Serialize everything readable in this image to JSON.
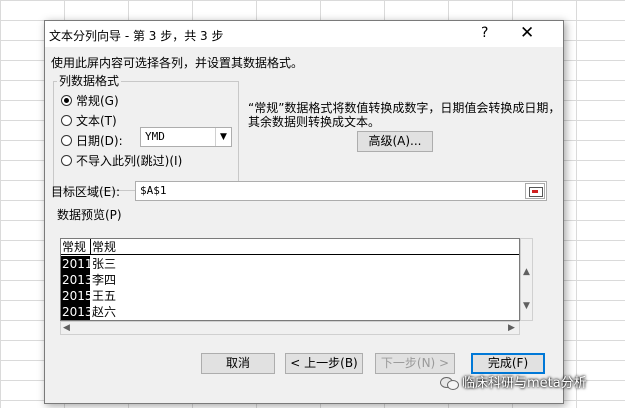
{
  "window": {
    "title": "文本分列向导 - 第 3 步，共 3 步",
    "help_glyph": "?",
    "close_glyph": "✕"
  },
  "instruction": "使用此屏内容可选择各列，并设置其数据格式。",
  "column_format": {
    "label": "列数据格式",
    "options": [
      {
        "label": "常规(G)",
        "selected": true
      },
      {
        "label": "文本(T)",
        "selected": false
      },
      {
        "label": "日期(D):",
        "selected": false
      },
      {
        "label": "不导入此列(跳过)(I)",
        "selected": false
      }
    ],
    "date_format": "YMD",
    "dropdown_arrow": "▼"
  },
  "info_text": "“常规”数据格式将数值转换成数字，日期值会转换成日期，其余数据则转换成文本。",
  "advanced_button": "高级(A)...",
  "destination": {
    "label": "目标区域(E):",
    "value": "$A$1"
  },
  "preview": {
    "label": "数据预览(P)",
    "headers": [
      "常规",
      "常规"
    ],
    "rows": [
      [
        "2011",
        "张三"
      ],
      [
        "2013",
        "李四"
      ],
      [
        "2015",
        "王五"
      ],
      [
        "2013",
        "赵六"
      ]
    ]
  },
  "scroll_arrows": {
    "up": "▲",
    "down": "▼",
    "left": "◀",
    "right": "▶"
  },
  "buttons": {
    "cancel": "取消",
    "back": "< 上一步(B)",
    "next": "下一步(N) >",
    "finish": "完成(F)"
  },
  "watermark": "临床科研与meta分析"
}
